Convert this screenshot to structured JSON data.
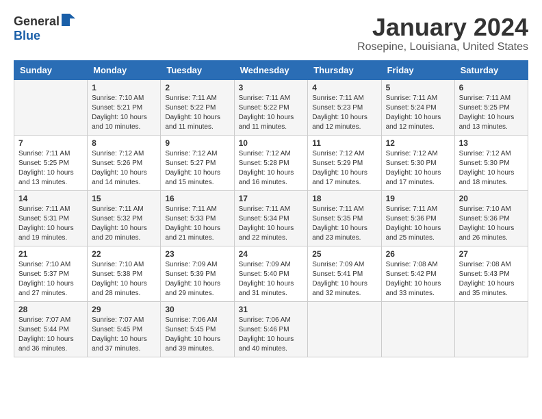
{
  "logo": {
    "line1": "General",
    "line2": "Blue"
  },
  "header": {
    "month": "January 2024",
    "location": "Rosepine, Louisiana, United States"
  },
  "weekdays": [
    "Sunday",
    "Monday",
    "Tuesday",
    "Wednesday",
    "Thursday",
    "Friday",
    "Saturday"
  ],
  "weeks": [
    [
      {
        "day": "",
        "info": ""
      },
      {
        "day": "1",
        "info": "Sunrise: 7:10 AM\nSunset: 5:21 PM\nDaylight: 10 hours\nand 10 minutes."
      },
      {
        "day": "2",
        "info": "Sunrise: 7:11 AM\nSunset: 5:22 PM\nDaylight: 10 hours\nand 11 minutes."
      },
      {
        "day": "3",
        "info": "Sunrise: 7:11 AM\nSunset: 5:22 PM\nDaylight: 10 hours\nand 11 minutes."
      },
      {
        "day": "4",
        "info": "Sunrise: 7:11 AM\nSunset: 5:23 PM\nDaylight: 10 hours\nand 12 minutes."
      },
      {
        "day": "5",
        "info": "Sunrise: 7:11 AM\nSunset: 5:24 PM\nDaylight: 10 hours\nand 12 minutes."
      },
      {
        "day": "6",
        "info": "Sunrise: 7:11 AM\nSunset: 5:25 PM\nDaylight: 10 hours\nand 13 minutes."
      }
    ],
    [
      {
        "day": "7",
        "info": "Sunrise: 7:11 AM\nSunset: 5:25 PM\nDaylight: 10 hours\nand 13 minutes."
      },
      {
        "day": "8",
        "info": "Sunrise: 7:12 AM\nSunset: 5:26 PM\nDaylight: 10 hours\nand 14 minutes."
      },
      {
        "day": "9",
        "info": "Sunrise: 7:12 AM\nSunset: 5:27 PM\nDaylight: 10 hours\nand 15 minutes."
      },
      {
        "day": "10",
        "info": "Sunrise: 7:12 AM\nSunset: 5:28 PM\nDaylight: 10 hours\nand 16 minutes."
      },
      {
        "day": "11",
        "info": "Sunrise: 7:12 AM\nSunset: 5:29 PM\nDaylight: 10 hours\nand 17 minutes."
      },
      {
        "day": "12",
        "info": "Sunrise: 7:12 AM\nSunset: 5:30 PM\nDaylight: 10 hours\nand 17 minutes."
      },
      {
        "day": "13",
        "info": "Sunrise: 7:12 AM\nSunset: 5:30 PM\nDaylight: 10 hours\nand 18 minutes."
      }
    ],
    [
      {
        "day": "14",
        "info": "Sunrise: 7:11 AM\nSunset: 5:31 PM\nDaylight: 10 hours\nand 19 minutes."
      },
      {
        "day": "15",
        "info": "Sunrise: 7:11 AM\nSunset: 5:32 PM\nDaylight: 10 hours\nand 20 minutes."
      },
      {
        "day": "16",
        "info": "Sunrise: 7:11 AM\nSunset: 5:33 PM\nDaylight: 10 hours\nand 21 minutes."
      },
      {
        "day": "17",
        "info": "Sunrise: 7:11 AM\nSunset: 5:34 PM\nDaylight: 10 hours\nand 22 minutes."
      },
      {
        "day": "18",
        "info": "Sunrise: 7:11 AM\nSunset: 5:35 PM\nDaylight: 10 hours\nand 23 minutes."
      },
      {
        "day": "19",
        "info": "Sunrise: 7:11 AM\nSunset: 5:36 PM\nDaylight: 10 hours\nand 25 minutes."
      },
      {
        "day": "20",
        "info": "Sunrise: 7:10 AM\nSunset: 5:36 PM\nDaylight: 10 hours\nand 26 minutes."
      }
    ],
    [
      {
        "day": "21",
        "info": "Sunrise: 7:10 AM\nSunset: 5:37 PM\nDaylight: 10 hours\nand 27 minutes."
      },
      {
        "day": "22",
        "info": "Sunrise: 7:10 AM\nSunset: 5:38 PM\nDaylight: 10 hours\nand 28 minutes."
      },
      {
        "day": "23",
        "info": "Sunrise: 7:09 AM\nSunset: 5:39 PM\nDaylight: 10 hours\nand 29 minutes."
      },
      {
        "day": "24",
        "info": "Sunrise: 7:09 AM\nSunset: 5:40 PM\nDaylight: 10 hours\nand 31 minutes."
      },
      {
        "day": "25",
        "info": "Sunrise: 7:09 AM\nSunset: 5:41 PM\nDaylight: 10 hours\nand 32 minutes."
      },
      {
        "day": "26",
        "info": "Sunrise: 7:08 AM\nSunset: 5:42 PM\nDaylight: 10 hours\nand 33 minutes."
      },
      {
        "day": "27",
        "info": "Sunrise: 7:08 AM\nSunset: 5:43 PM\nDaylight: 10 hours\nand 35 minutes."
      }
    ],
    [
      {
        "day": "28",
        "info": "Sunrise: 7:07 AM\nSunset: 5:44 PM\nDaylight: 10 hours\nand 36 minutes."
      },
      {
        "day": "29",
        "info": "Sunrise: 7:07 AM\nSunset: 5:45 PM\nDaylight: 10 hours\nand 37 minutes."
      },
      {
        "day": "30",
        "info": "Sunrise: 7:06 AM\nSunset: 5:45 PM\nDaylight: 10 hours\nand 39 minutes."
      },
      {
        "day": "31",
        "info": "Sunrise: 7:06 AM\nSunset: 5:46 PM\nDaylight: 10 hours\nand 40 minutes."
      },
      {
        "day": "",
        "info": ""
      },
      {
        "day": "",
        "info": ""
      },
      {
        "day": "",
        "info": ""
      }
    ]
  ]
}
